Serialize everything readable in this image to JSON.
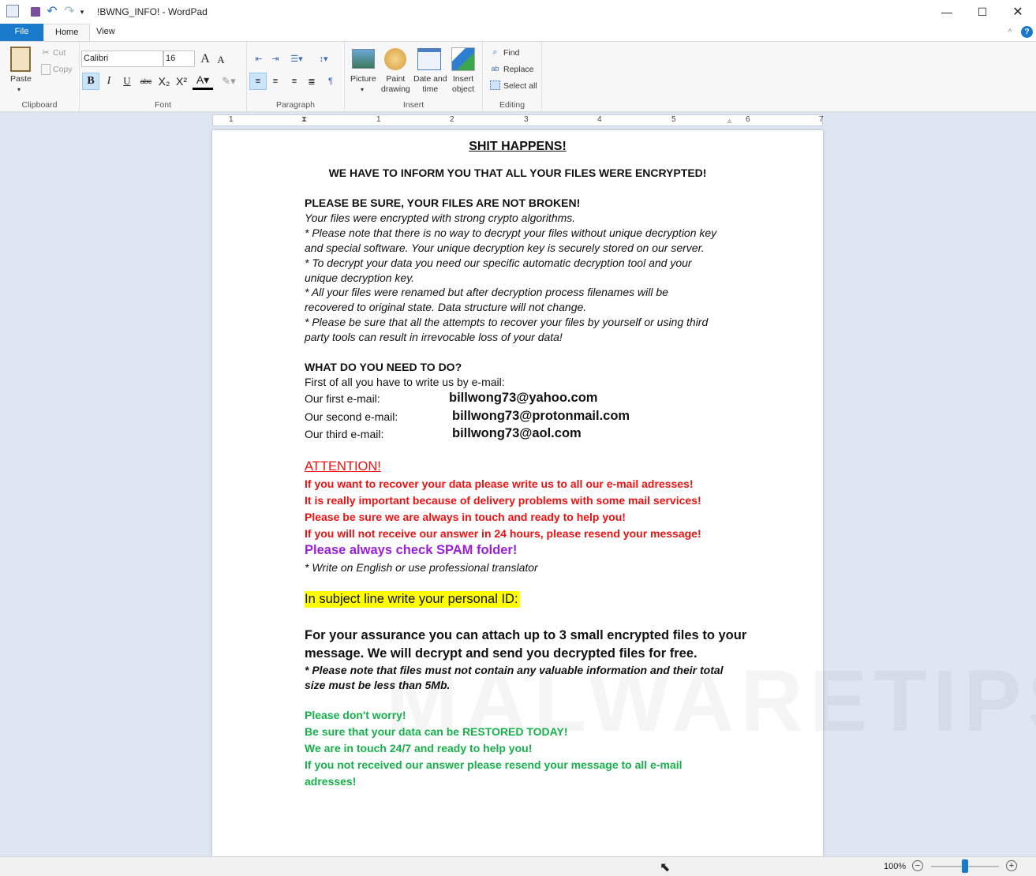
{
  "window": {
    "title": "!BWNG_INFO! - WordPad"
  },
  "tabs": [
    {
      "label": "File"
    },
    {
      "label": "Home"
    },
    {
      "label": "View"
    }
  ],
  "ribbon": {
    "clipboard": {
      "label": "Clipboard",
      "paste": "Paste",
      "cut": "Cut",
      "copy": "Copy"
    },
    "font": {
      "label": "Font",
      "family": "Calibri",
      "size": "16"
    },
    "paragraph": {
      "label": "Paragraph"
    },
    "insert": {
      "label": "Insert",
      "picture": "Picture",
      "paint1": "Paint",
      "paint2": "drawing",
      "date1": "Date and",
      "date2": "time",
      "obj1": "Insert",
      "obj2": "object"
    },
    "editing": {
      "label": "Editing",
      "find": "Find",
      "replace": "Replace",
      "select_all": "Select all"
    }
  },
  "ruler": {
    "marks": [
      "1",
      "1",
      "2",
      "3",
      "4",
      "5",
      "6",
      "7"
    ]
  },
  "document": {
    "title": "SHIT HAPPENS!",
    "heading": "WE HAVE TO INFORM YOU THAT ALL YOUR FILES WERE ENCRYPTED!",
    "s1_head": "PLEASE BE SURE, YOUR FILES ARE NOT BROKEN!",
    "s1_lines": [
      "Your files were encrypted with strong crypto algorithms.",
      "* Please note that there is no way to decrypt your files without unique decryption key",
      "and special software.  Your unique decryption key is securely stored on our server.",
      "* To decrypt your data you need our specific automatic decryption tool and your",
      "unique decryption key.",
      "* All your files were renamed but after decryption process filenames will be",
      "recovered to original state. Data structure will not change.",
      "* Please be sure that all the attempts to recover your files by yourself or using third",
      "party tools can result in irrevocable loss of your data!"
    ],
    "s2_head": "WHAT DO YOU NEED TO DO?",
    "s2_intro": "First of all you have to write us by e-mail:",
    "emails": [
      {
        "label": "Our first e-mail:",
        "value": "billwong73@yahoo.com"
      },
      {
        "label": "Our second e-mail:",
        "value": "billwong73@protonmail.com"
      },
      {
        "label": "Our third e-mail:",
        "value": "billwong73@aol.com"
      }
    ],
    "attention": "ATTENTION!",
    "red_lines": [
      "If you want to recover your data please write us to all our e-mail adresses!",
      "It is really important because of delivery problems with some mail services!",
      "Please be sure we are always in touch and ready to help you!",
      "If you will not receive our answer in 24 hours, please resend your message!"
    ],
    "spam": "Please always check SPAM folder!",
    "translator": "* Write on English or use professional translator",
    "subject": "In subject line write your personal ID:",
    "assurance": [
      "For your assurance you can attach up to 3 small encrypted files to your",
      "message. We will decrypt and send you decrypted files for free."
    ],
    "note": [
      "*   Please note that files must not contain any valuable information and their total",
      "size must be less than 5Mb."
    ],
    "green_lines": [
      "Please don't worry!",
      "Be sure that your data can be RESTORED TODAY!",
      "We are in touch 24/7 and ready to help you!",
      "If you not received our answer please resend your message to all e-mail",
      "adresses!"
    ]
  },
  "watermark": "MALWARETIPS",
  "status": {
    "zoom": "100%",
    "zoom_level_percent": 100
  },
  "colors": {
    "file_tab": "#1979ca",
    "red": "#ee1111",
    "green": "#16b14a",
    "purple": "#9b1fd6",
    "highlight": "#ffff00"
  }
}
